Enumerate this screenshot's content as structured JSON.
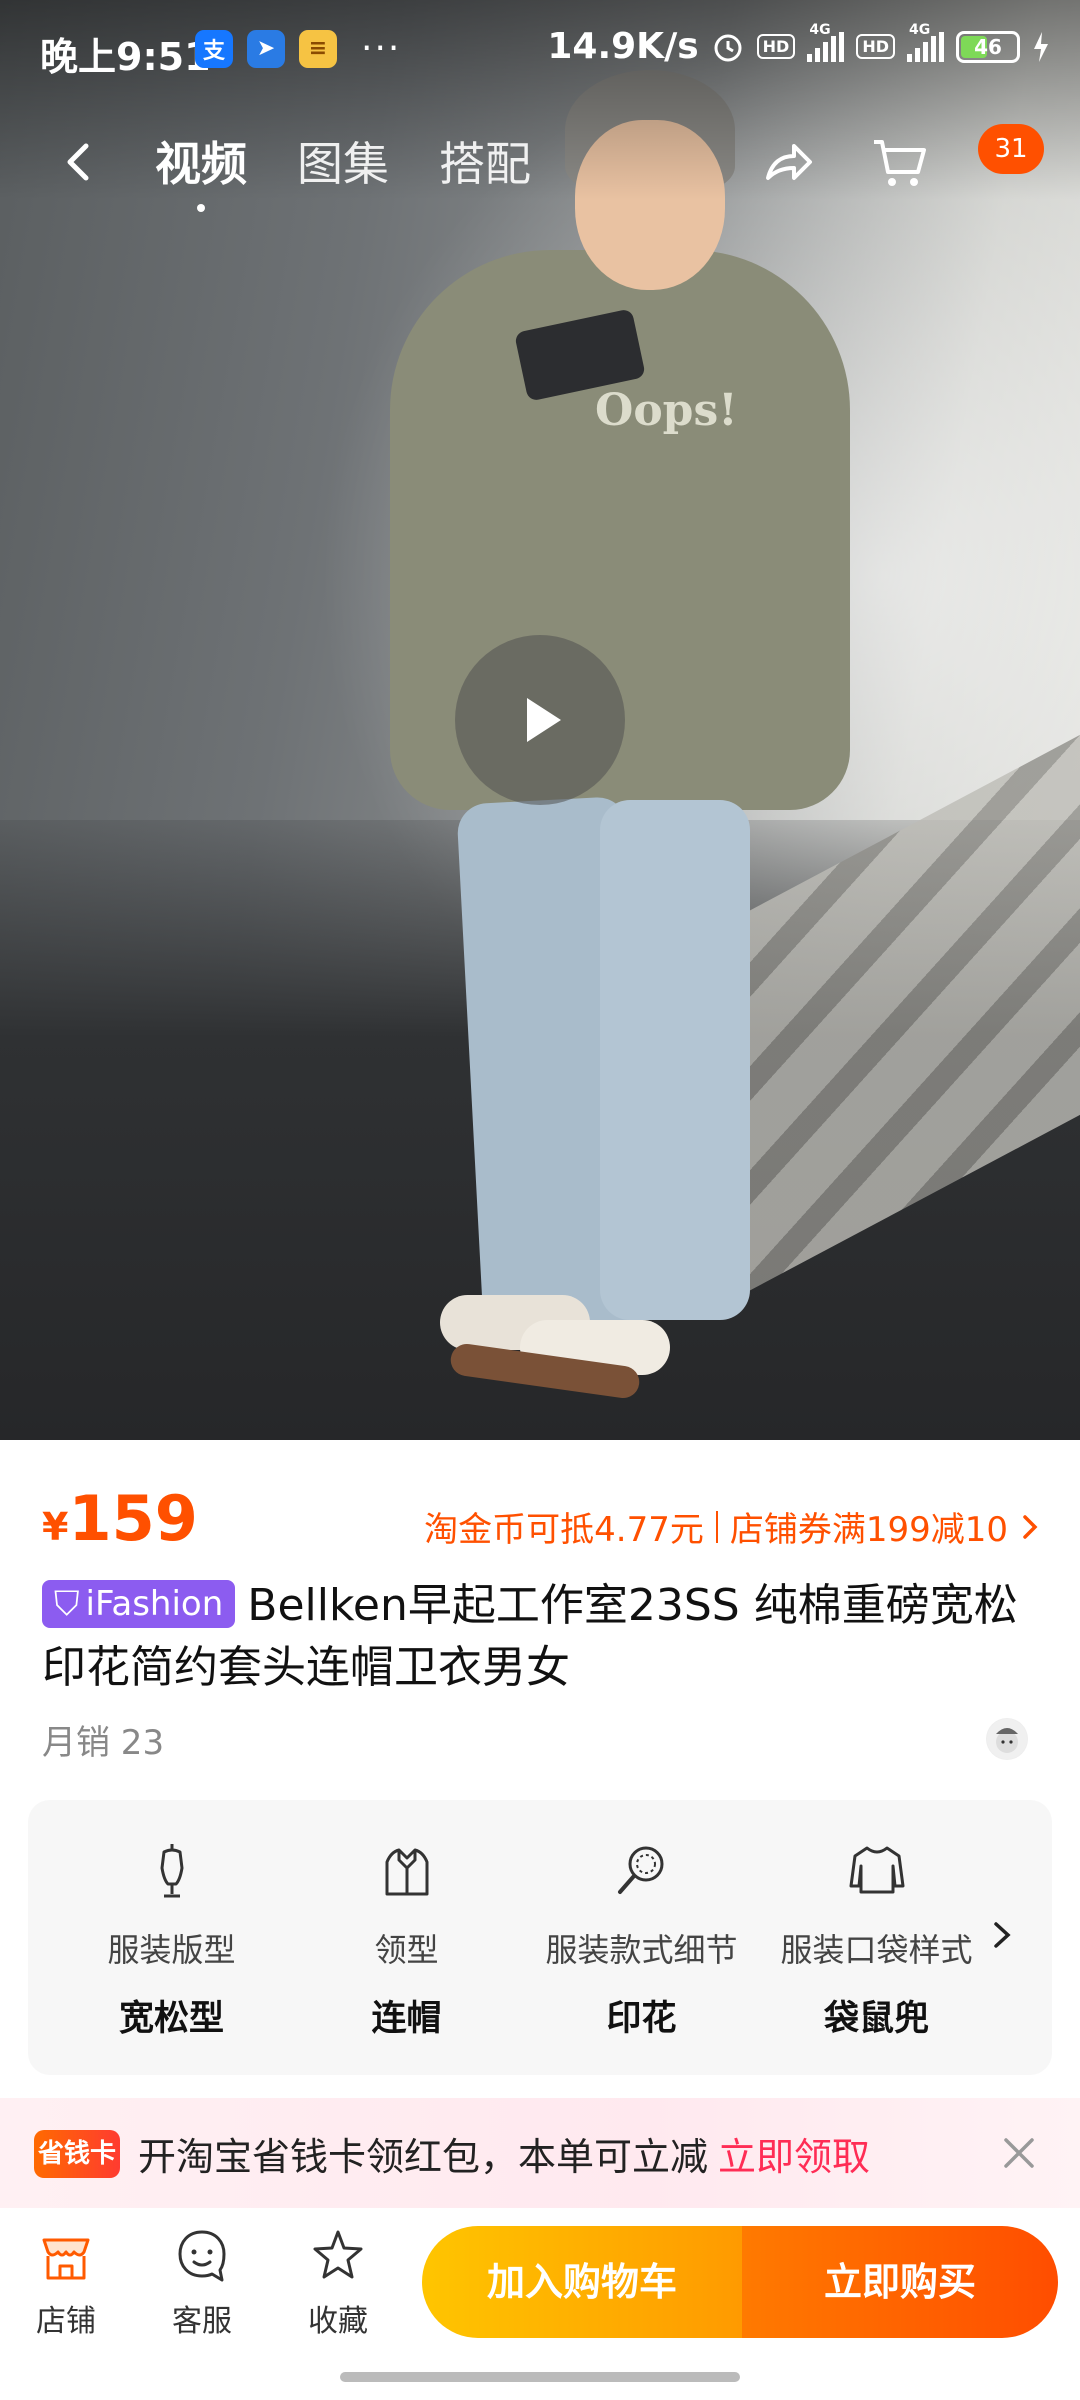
{
  "status_bar": {
    "time": "晚上9:51",
    "app_icons": [
      "alipay-icon",
      "navigation-icon",
      "taobao-coin-icon"
    ],
    "more": "···",
    "net_speed": "14.9K/s",
    "hd1": "HD",
    "net1": "4G",
    "hd2": "HD",
    "net2": "4G",
    "battery": "46"
  },
  "top_nav": {
    "tabs": [
      {
        "label": "视频",
        "active": true
      },
      {
        "label": "图集",
        "active": false
      },
      {
        "label": "搭配",
        "active": false
      }
    ],
    "cart_badge": "31"
  },
  "media": {
    "hoodie_print": "Oops!"
  },
  "price": {
    "currency": "¥",
    "amount": "159",
    "promo_coin": "淘金币可抵4.77元",
    "promo_coupon": "店铺券满199减10"
  },
  "product": {
    "tag": "iFashion",
    "title": "Bellken早起工作室23SS 纯棉重磅宽松印花简约套头连帽卫衣男女",
    "sales": "月销 23"
  },
  "attributes": [
    {
      "icon": "mannequin-icon",
      "label": "服装版型",
      "value": "宽松型"
    },
    {
      "icon": "collar-icon",
      "label": "领型",
      "value": "连帽"
    },
    {
      "icon": "magnifier-icon",
      "label": "服装款式细节",
      "value": "印花"
    },
    {
      "icon": "sweater-icon",
      "label": "服装口袋样式",
      "value": "袋鼠兜"
    }
  ],
  "banner": {
    "pill": "省钱卡",
    "text": "开淘宝省钱卡领红包，本单可立减",
    "cta": "立即领取"
  },
  "bottom_bar": {
    "store": "店铺",
    "service": "客服",
    "favorite": "收藏",
    "add_to_cart": "加入购物车",
    "buy_now": "立即购买"
  },
  "colors": {
    "accent": "#ff5000",
    "tag": "#8c5cf0",
    "cart_btn": "#ffb300",
    "buy_btn": "#ff5a00"
  }
}
